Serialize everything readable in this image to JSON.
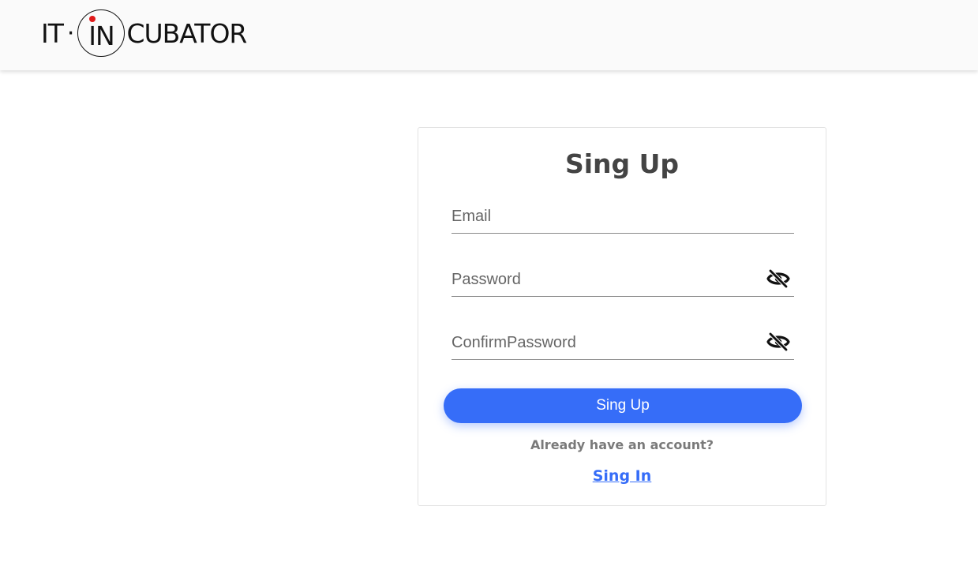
{
  "header": {
    "logo": {
      "part1": "IT",
      "separator": "·",
      "part2": "IN",
      "part3": "CUBATOR"
    }
  },
  "form": {
    "title": "Sing Up",
    "fields": {
      "email": {
        "placeholder": "Email",
        "value": ""
      },
      "password": {
        "placeholder": "Password",
        "value": "",
        "icon": "eye-off-icon"
      },
      "confirm": {
        "placeholder": "ConfirmPassword",
        "value": "",
        "icon": "eye-off-icon"
      }
    },
    "submit_label": "Sing Up",
    "already_text": "Already have an account?",
    "signin_link": "Sing In"
  },
  "colors": {
    "accent": "#366df8",
    "logo_dot": "#e01a1a",
    "title": "#444444",
    "muted": "#7a7a7a"
  }
}
